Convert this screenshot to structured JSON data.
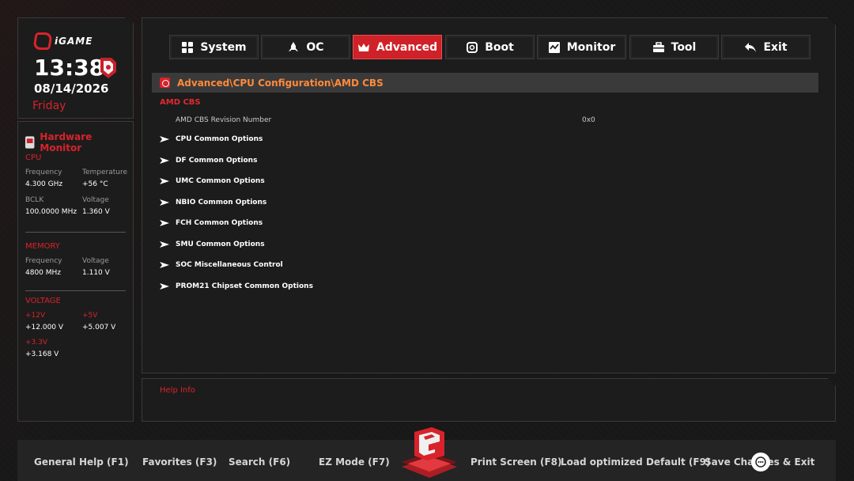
{
  "brand": {
    "logo_text": "iGAME"
  },
  "clock": {
    "time": "13:38",
    "date": "08/14/2026",
    "day": "Friday"
  },
  "hardware_monitor": {
    "title": "Hardware Monitor",
    "cpu": {
      "section": "CPU",
      "frequency_label": "Frequency",
      "frequency_value": "4.300 GHz",
      "temperature_label": "Temperature",
      "temperature_value": "+56 °C",
      "bclk_label": "BCLK",
      "bclk_value": "100.0000 MHz",
      "voltage_label": "Voltage",
      "voltage_value": "1.360 V"
    },
    "memory": {
      "section": "MEMORY",
      "frequency_label": "Frequency",
      "frequency_value": "4800 MHz",
      "voltage_label": "Voltage",
      "voltage_value": "1.110 V"
    },
    "voltage": {
      "section": "VOLTAGE",
      "v12_label": "+12V",
      "v12_value": "+12.000 V",
      "v5_label": "+5V",
      "v5_value": "+5.007 V",
      "v33_label": "+3.3V",
      "v33_value": "+3.168 V"
    }
  },
  "tabs": [
    {
      "label": "System",
      "icon": "grid-icon"
    },
    {
      "label": "OC",
      "icon": "rocket-icon"
    },
    {
      "label": "Advanced",
      "icon": "crown-icon",
      "active": true
    },
    {
      "label": "Boot",
      "icon": "power-icon"
    },
    {
      "label": "Monitor",
      "icon": "monitor-icon"
    },
    {
      "label": "Tool",
      "icon": "toolbox-icon"
    },
    {
      "label": "Exit",
      "icon": "back-arrow-icon"
    }
  ],
  "breadcrumb": "Advanced\\CPU Configuration\\AMD CBS",
  "content": {
    "section_title": "AMD CBS",
    "info_label": "AMD CBS Revision Number",
    "info_value": "0x0",
    "items": [
      "CPU Common Options",
      "DF Common Options",
      "UMC Common Options",
      "NBIO Common Options",
      "FCH Common Options",
      "SMU Common Options",
      "SOC Miscellaneous Control",
      "PROM21 Chipset Common Options"
    ]
  },
  "help": {
    "title": "Help Info"
  },
  "footer": {
    "general_help": "General Help (F1)",
    "favorites": "Favorites (F3)",
    "search": "Search (F6)",
    "ez_mode": "EZ Mode (F7)",
    "print_screen": "Print Screen (F8)",
    "load_defaults": "Load optimized Default (F9)",
    "save_changes": "Save Changes & Exit"
  },
  "colors": {
    "accent": "#d8232a",
    "breadcrumb": "#ff8a3c",
    "panel": "#1c1c1c"
  }
}
